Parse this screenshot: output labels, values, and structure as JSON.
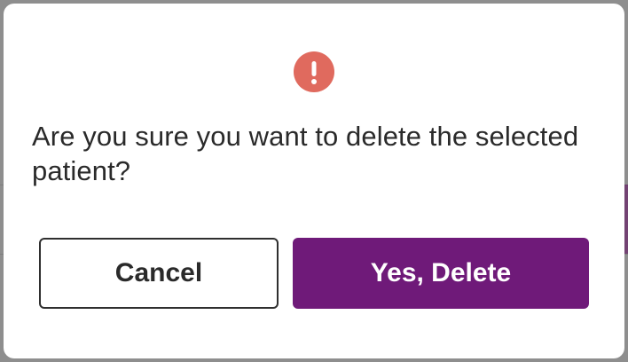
{
  "dialog": {
    "icon": "alert-exclamation-icon",
    "message": "Are you sure you want to delete the selected patient?",
    "cancel_label": "Cancel",
    "confirm_label": "Yes, Delete"
  },
  "colors": {
    "alert_icon": "#e06a5e",
    "confirm_button": "#6f1a79",
    "text": "#2a2a2a",
    "backdrop": "#8e8e8e"
  }
}
